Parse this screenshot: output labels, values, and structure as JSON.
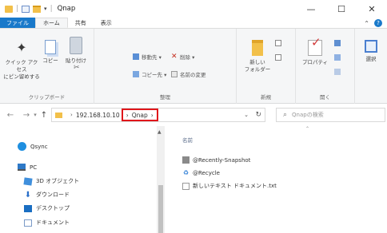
{
  "window": {
    "title": "Qnap",
    "minimize_glyph": "—",
    "maximize_glyph": "☐",
    "close_glyph": "✕",
    "quick_access_chevron": "▾"
  },
  "ribbon_tabs": {
    "file": "ファイル",
    "home": "ホーム",
    "share": "共有",
    "view": "表示",
    "collapse_glyph": "⌃",
    "help_glyph": "?"
  },
  "ribbon": {
    "clipboard": {
      "pin_label_1": "クイック アクセス",
      "pin_label_2": "にピン留めする",
      "copy_label": "コピー",
      "paste_label": "貼り付け",
      "group_label": "クリップボード"
    },
    "organize": {
      "move_to": "移動先 ▾",
      "copy_to": "コピー先 ▾",
      "delete": "削除 ▾",
      "rename": "名前の変更",
      "group_label": "整理"
    },
    "new": {
      "new_folder_1": "新しい",
      "new_folder_2": "フォルダー",
      "group_label": "新規"
    },
    "open": {
      "properties": "プロパティ",
      "group_label": "開く"
    },
    "select": {
      "select_label": "選択"
    }
  },
  "address": {
    "back": "←",
    "forward": "→",
    "recent": "▾",
    "up": "↑",
    "path_root": "192.168.10.10",
    "path_current": "Qnap",
    "separator": "›",
    "dropdown": "⌄",
    "refresh": "↻",
    "search_placeholder": "Qnapの検索",
    "search_icon": "⌕"
  },
  "nav_pane": {
    "items": [
      {
        "label": "Qsync",
        "icon": "qsync-icon"
      },
      {
        "label": "PC",
        "icon": "pc-icon"
      },
      {
        "label": "3D オブジェクト",
        "icon": "3d-objects-icon"
      },
      {
        "label": "ダウンロード",
        "icon": "download-icon"
      },
      {
        "label": "デスクトップ",
        "icon": "desktop-icon"
      },
      {
        "label": "ドキュメント",
        "icon": "documents-icon"
      }
    ],
    "scroll_up": "▲"
  },
  "content": {
    "column_name": "名前",
    "sort_caret": "⌃",
    "files": [
      {
        "name": "@Recently-Snapshot",
        "icon": "snapshot-folder-icon"
      },
      {
        "name": "@Recycle",
        "icon": "recycle-bin-icon"
      },
      {
        "name": "新しいテキスト ドキュメント.txt",
        "icon": "text-file-icon"
      }
    ]
  }
}
